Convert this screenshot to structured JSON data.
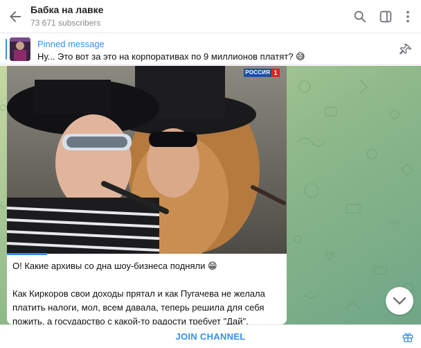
{
  "header": {
    "title": "Бабка на лавке",
    "subscribers": "73 671 subscribers",
    "icons": [
      "back-arrow-icon",
      "search-icon",
      "sidebar-toggle-icon",
      "more-vert-icon"
    ]
  },
  "pinned": {
    "title": "Pinned message",
    "text": "Ну... Это вот за это на корпоративах по 9 миллионов платят? 😅",
    "icon": "pinned-list-icon"
  },
  "message": {
    "channel_logo": "РОССИЯ",
    "channel_logo_num": "1",
    "caption_line1": "О! Какие архивы со дна шоу-бизнеса подняли 😁",
    "caption_line2": "Как Киркоров свои доходы прятал и как Пугачева не желала",
    "caption_line3": "платить налоги, мол, всем давала, теперь решила для себя",
    "caption_line4": "пожить, а государство с какой-то радости требует \"Дай\"."
  },
  "footer": {
    "join_label": "JOIN CHANNEL",
    "icon": "gift-icon"
  },
  "colors": {
    "accent": "#3390ec",
    "chat_background": "#a4c28f"
  }
}
